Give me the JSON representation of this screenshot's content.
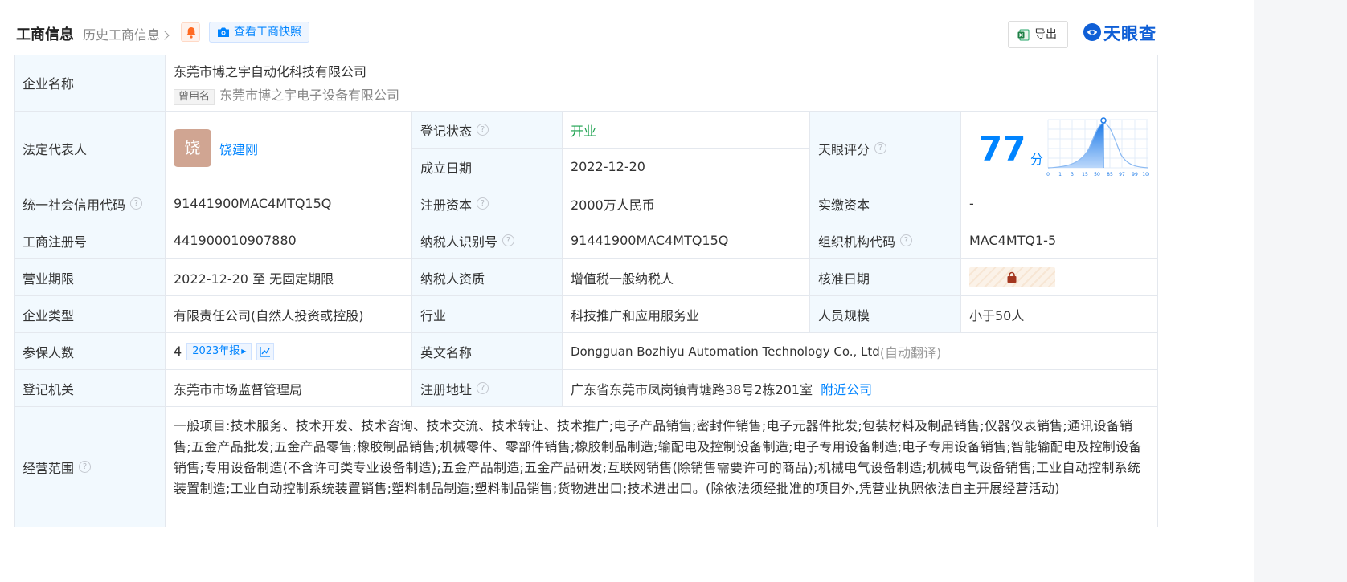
{
  "header": {
    "title": "工商信息",
    "history_label": "历史工商信息",
    "snapshot_label": "查看工商快照",
    "export_label": "导出",
    "brand": "天眼查"
  },
  "company": {
    "name_label": "企业名称",
    "name": "东莞市博之宇自动化科技有限公司",
    "former_tag": "曾用名",
    "former_name": "东莞市博之宇电子设备有限公司"
  },
  "legal_rep": {
    "label": "法定代表人",
    "avatar_char": "饶",
    "name": "饶建刚"
  },
  "reg_status": {
    "label": "登记状态",
    "value": "开业"
  },
  "found_date": {
    "label": "成立日期",
    "value": "2022-12-20"
  },
  "tianyan_score": {
    "label": "天眼评分",
    "value": "77",
    "unit": "分",
    "axis_ticks": [
      "0",
      "1",
      "3",
      "15",
      "50",
      "85",
      "97",
      "99",
      "100"
    ]
  },
  "credit_code": {
    "label": "统一社会信用代码",
    "value": "91441900MAC4MTQ15Q"
  },
  "reg_capital": {
    "label": "注册资本",
    "value": "2000万人民币"
  },
  "paid_capital": {
    "label": "实缴资本",
    "value": "-"
  },
  "reg_number": {
    "label": "工商注册号",
    "value": "441900010907880"
  },
  "taxpayer_id": {
    "label": "纳税人识别号",
    "value": "91441900MAC4MTQ15Q"
  },
  "org_code": {
    "label": "组织机构代码",
    "value": "MAC4MTQ1-5"
  },
  "business_term": {
    "label": "营业期限",
    "value": "2022-12-20 至 无固定期限"
  },
  "taxpayer_qual": {
    "label": "纳税人资质",
    "value": "增值税一般纳税人"
  },
  "approval_date": {
    "label": "核准日期",
    "locked_icon": "lock-icon"
  },
  "company_type": {
    "label": "企业类型",
    "value": "有限责任公司(自然人投资或控股)"
  },
  "industry": {
    "label": "行业",
    "value": "科技推广和应用服务业"
  },
  "staff_size": {
    "label": "人员规模",
    "value": "小于50人"
  },
  "insured": {
    "label": "参保人数",
    "value": "4",
    "year_tag": "2023年报"
  },
  "english_name": {
    "label": "英文名称",
    "value": "Dongguan Bozhiyu Automation Technology Co., Ltd",
    "note": "(自动翻译)"
  },
  "reg_authority": {
    "label": "登记机关",
    "value": "东莞市市场监督管理局"
  },
  "reg_address": {
    "label": "注册地址",
    "value": "广东省东莞市凤岗镇青塘路38号2栋201室",
    "nearby_link": "附近公司"
  },
  "business_scope": {
    "label": "经营范围",
    "value": "一般项目:技术服务、技术开发、技术咨询、技术交流、技术转让、技术推广;电子产品销售;密封件销售;电子元器件批发;包装材料及制品销售;仪器仪表销售;通讯设备销售;五金产品批发;五金产品零售;橡胶制品销售;机械零件、零部件销售;橡胶制品制造;输配电及控制设备制造;电子专用设备制造;电子专用设备销售;智能输配电及控制设备销售;专用设备制造(不含许可类专业设备制造);五金产品制造;五金产品研发;互联网销售(除销售需要许可的商品);机械电气设备制造;机械电气设备销售;工业自动控制系统装置制造;工业自动控制系统装置销售;塑料制品制造;塑料制品销售;货物进出口;技术进出口。(除依法须经批准的项目外,凭营业执照依法自主开展经营活动)"
  },
  "colors": {
    "accent": "#0084ff",
    "label_bg": "#f2f9fe",
    "status_green": "#19a04c",
    "avatar_bg": "#d0a592"
  }
}
